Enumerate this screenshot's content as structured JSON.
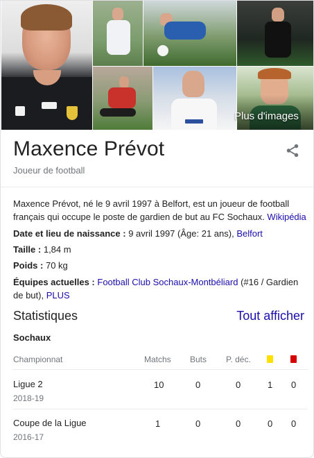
{
  "images": {
    "more_label": "Plus d'images"
  },
  "entity": {
    "name": "Maxence Prévot",
    "type": "Joueur de football"
  },
  "description": {
    "text": "Maxence Prévot, né le 9 avril 1997 à Belfort, est un joueur de football français qui occupe le poste de gardien de but au FC Sochaux.",
    "source_link": "Wikipédia"
  },
  "facts": {
    "birth": {
      "label": "Date et lieu de naissance :",
      "value": "9 avril 1997 (Âge: 21 ans),",
      "link": "Belfort"
    },
    "height": {
      "label": "Taille :",
      "value": "1,84 m"
    },
    "weight": {
      "label": "Poids :",
      "value": "70 kg"
    },
    "teams": {
      "label": "Équipes actuelles :",
      "link": "Football Club Sochaux-Montbéliard",
      "value": "(#16 / Gardien de but),",
      "more_link": "PLUS"
    }
  },
  "stats": {
    "title": "Statistiques",
    "see_all": "Tout afficher",
    "team": "Sochaux",
    "headers": {
      "competition": "Championnat",
      "matches": "Matchs",
      "goals": "Buts",
      "assists": "P. déc."
    },
    "card_colors": {
      "yellow": "#ffe000",
      "red": "#d50000"
    },
    "rows": [
      {
        "competition": "Ligue 2",
        "season": "2018-19",
        "matches": "10",
        "goals": "0",
        "assists": "0",
        "yellow": "1",
        "red": "0"
      },
      {
        "competition": "Coupe de la Ligue",
        "season": "2016-17",
        "matches": "1",
        "goals": "0",
        "assists": "0",
        "yellow": "0",
        "red": "0"
      }
    ]
  }
}
